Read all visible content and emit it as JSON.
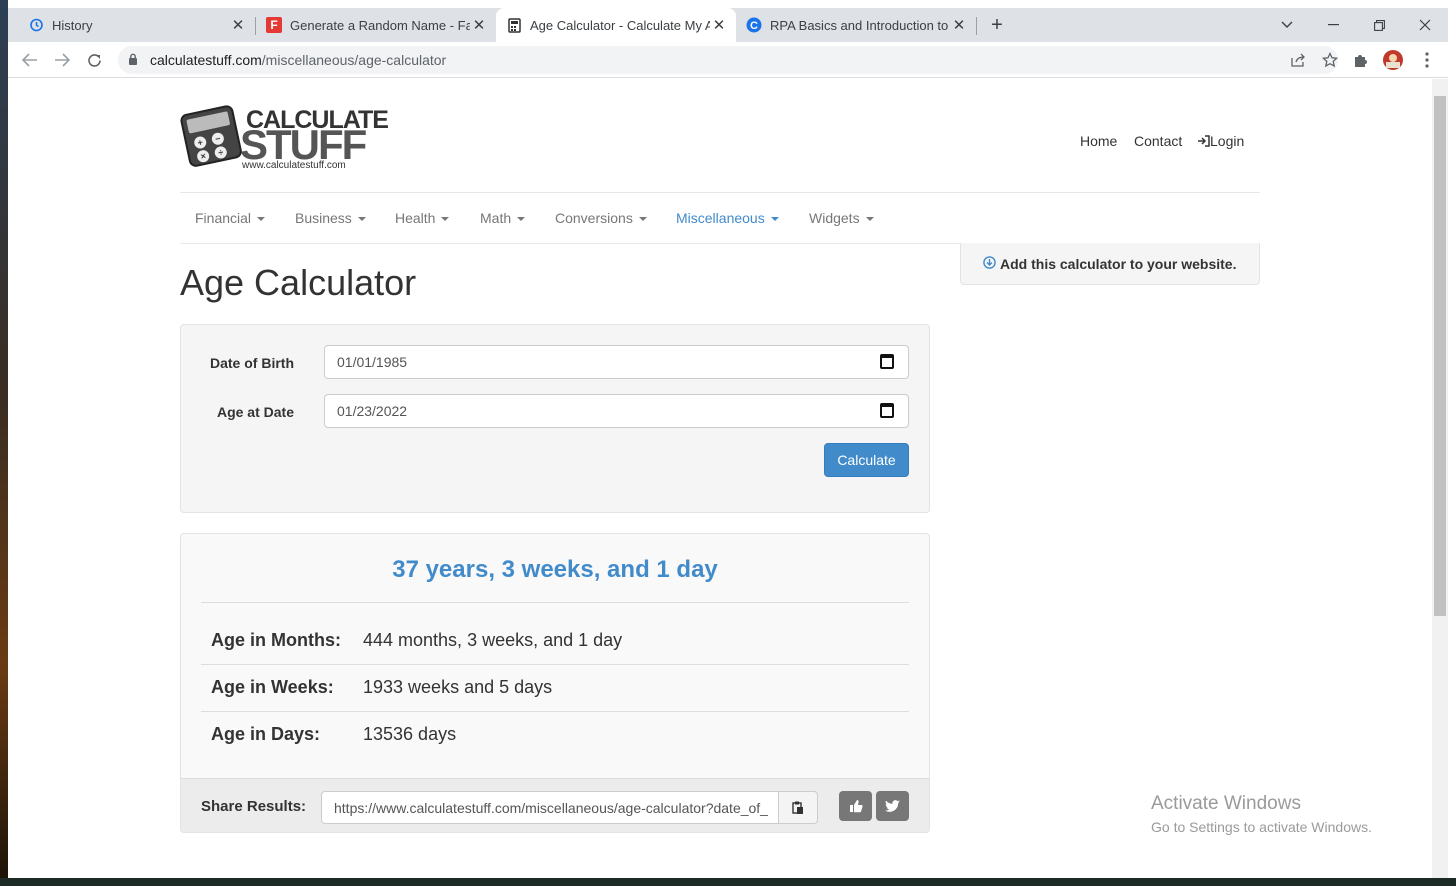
{
  "browser": {
    "tabs": [
      {
        "title": "History"
      },
      {
        "title": "Generate a Random Name - Fake"
      },
      {
        "title": "Age Calculator - Calculate My Ag"
      },
      {
        "title": "RPA Basics and Introduction to U"
      }
    ],
    "url_domain": "calculatestuff.com",
    "url_path": "/miscellaneous/age-calculator"
  },
  "site": {
    "logo_text_top": "CALCULATE",
    "logo_text_bottom": "STUFF",
    "logo_url": "www.calculatestuff.com",
    "topnav": {
      "home": "Home",
      "contact": "Contact",
      "login": "Login"
    },
    "menu": [
      "Financial",
      "Business",
      "Health",
      "Math",
      "Conversions",
      "Miscellaneous",
      "Widgets"
    ],
    "active_menu": "Miscellaneous",
    "add_widget": "Add this calculator to your website."
  },
  "calculator": {
    "title": "Age Calculator",
    "dob_label": "Date of Birth",
    "dob_value": "01/01/1985",
    "age_at_label": "Age at Date",
    "age_at_value": "01/23/2022",
    "button": "Calculate"
  },
  "result": {
    "headline": "37 years, 3 weeks, and 1 day",
    "rows": [
      {
        "label": "Age in Months:",
        "value": "444 months, 3 weeks, and 1 day"
      },
      {
        "label": "Age in Weeks:",
        "value": "1933 weeks and 5 days"
      },
      {
        "label": "Age in Days:",
        "value": "13536 days"
      }
    ],
    "share_label": "Share Results:",
    "share_url": "https://www.calculatestuff.com/miscellaneous/age-calculator?date_of_"
  },
  "watermark": {
    "line1": "Activate Windows",
    "line2": "Go to Settings to activate Windows."
  },
  "colors": {
    "accent": "#428bca",
    "chrome_bg": "#dee1e6"
  }
}
